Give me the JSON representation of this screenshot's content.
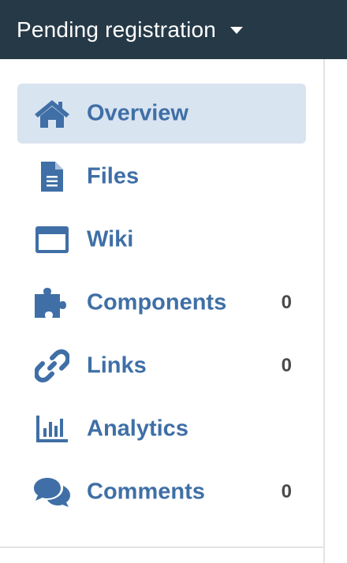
{
  "header": {
    "title": "Pending registration",
    "caret_icon": "caret-down-icon"
  },
  "nav": {
    "accent_color": "#3f6fa6",
    "active_bg": "#d9e4f1",
    "items": [
      {
        "label": "Overview",
        "icon": "home-icon",
        "count": "",
        "active": true
      },
      {
        "label": "Files",
        "icon": "file-icon",
        "count": "",
        "active": false
      },
      {
        "label": "Wiki",
        "icon": "window-icon",
        "count": "",
        "active": false
      },
      {
        "label": "Components",
        "icon": "puzzle-icon",
        "count": "0",
        "active": false
      },
      {
        "label": "Links",
        "icon": "link-icon",
        "count": "0",
        "active": false
      },
      {
        "label": "Analytics",
        "icon": "bar-chart-icon",
        "count": "",
        "active": false
      },
      {
        "label": "Comments",
        "icon": "comments-icon",
        "count": "0",
        "active": false
      }
    ]
  }
}
